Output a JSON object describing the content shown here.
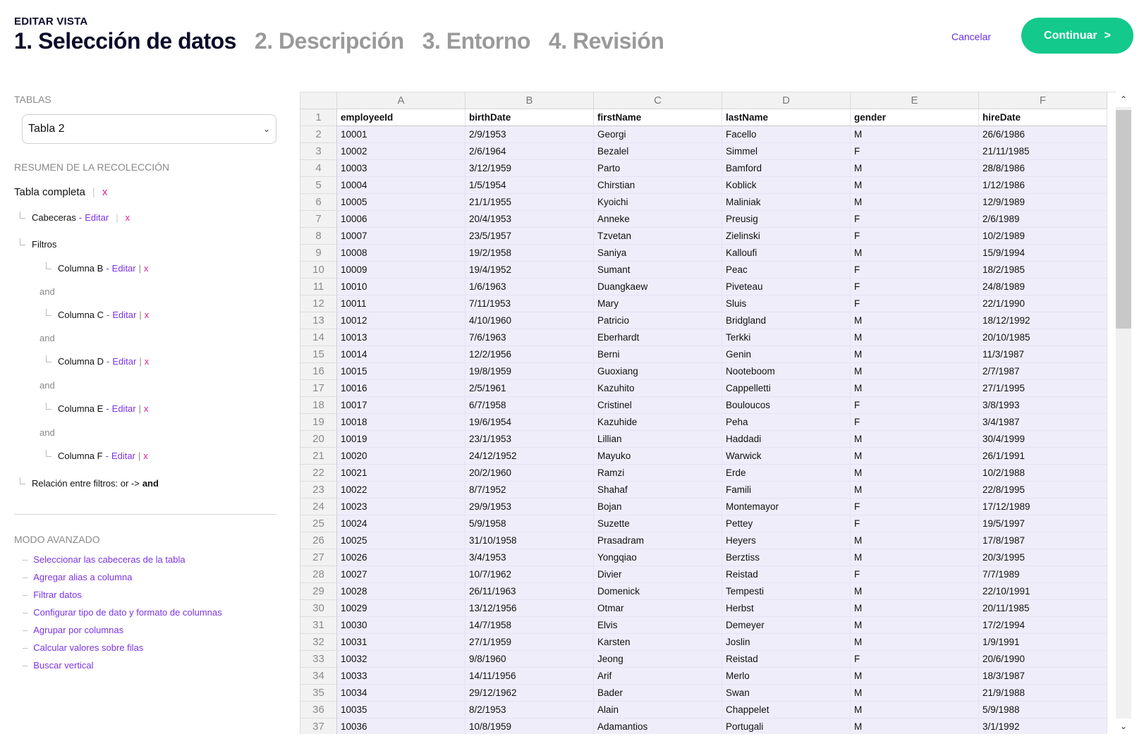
{
  "header": {
    "pretitle": "EDITAR VISTA",
    "steps": [
      {
        "label": "1. Selección de datos"
      },
      {
        "label": "2. Descripción"
      },
      {
        "label": "3. Entorno"
      },
      {
        "label": "4. Revisión"
      }
    ],
    "cancel_label": "Cancelar",
    "continue_label": "Continuar",
    "continue_arrow": ">"
  },
  "sidebar": {
    "tables_title": "TABLAS",
    "selected_table": "Tabla 2",
    "summary_title": "RESUMEN DE LA RECOLECCIÓN",
    "full_table": "Tabla completa",
    "remove_x": "x",
    "headers_label": "Cabeceras",
    "edit_label": "Editar",
    "dash": "-",
    "pipe": "|",
    "filters_label": "Filtros",
    "filters": [
      {
        "label": "Columna B"
      },
      {
        "label": "Columna C"
      },
      {
        "label": "Columna D"
      },
      {
        "label": "Columna E"
      },
      {
        "label": "Columna F"
      }
    ],
    "and_label": "and",
    "relation_label": "Relación entre filtros: or ->",
    "relation_value": "and",
    "advanced_title": "MODO AVANZADO",
    "advanced_items": [
      "Seleccionar las cabeceras de la tabla",
      "Agregar alias a columna",
      "Filtrar datos",
      "Configurar tipo de dato y formato de columnas",
      "Agrupar por columnas",
      "Calcular valores sobre filas",
      "Buscar vertical"
    ]
  },
  "grid": {
    "columns": [
      "A",
      "B",
      "C",
      "D",
      "E",
      "F"
    ],
    "header_row": [
      "employeeId",
      "birthDate",
      "firstName",
      "lastName",
      "gender",
      "hireDate"
    ],
    "rows": [
      [
        "10001",
        "2/9/1953",
        "Georgi",
        "Facello",
        "M",
        "26/6/1986"
      ],
      [
        "10002",
        "2/6/1964",
        "Bezalel",
        "Simmel",
        "F",
        "21/11/1985"
      ],
      [
        "10003",
        "3/12/1959",
        "Parto",
        "Bamford",
        "M",
        "28/8/1986"
      ],
      [
        "10004",
        "1/5/1954",
        "Chirstian",
        "Koblick",
        "M",
        "1/12/1986"
      ],
      [
        "10005",
        "21/1/1955",
        "Kyoichi",
        "Maliniak",
        "M",
        "12/9/1989"
      ],
      [
        "10006",
        "20/4/1953",
        "Anneke",
        "Preusig",
        "F",
        "2/6/1989"
      ],
      [
        "10007",
        "23/5/1957",
        "Tzvetan",
        "Zielinski",
        "F",
        "10/2/1989"
      ],
      [
        "10008",
        "19/2/1958",
        "Saniya",
        "Kalloufi",
        "M",
        "15/9/1994"
      ],
      [
        "10009",
        "19/4/1952",
        "Sumant",
        "Peac",
        "F",
        "18/2/1985"
      ],
      [
        "10010",
        "1/6/1963",
        "Duangkaew",
        "Piveteau",
        "F",
        "24/8/1989"
      ],
      [
        "10011",
        "7/11/1953",
        "Mary",
        "Sluis",
        "F",
        "22/1/1990"
      ],
      [
        "10012",
        "4/10/1960",
        "Patricio",
        "Bridgland",
        "M",
        "18/12/1992"
      ],
      [
        "10013",
        "7/6/1963",
        "Eberhardt",
        "Terkki",
        "M",
        "20/10/1985"
      ],
      [
        "10014",
        "12/2/1956",
        "Berni",
        "Genin",
        "M",
        "11/3/1987"
      ],
      [
        "10015",
        "19/8/1959",
        "Guoxiang",
        "Nooteboom",
        "M",
        "2/7/1987"
      ],
      [
        "10016",
        "2/5/1961",
        "Kazuhito",
        "Cappelletti",
        "M",
        "27/1/1995"
      ],
      [
        "10017",
        "6/7/1958",
        "Cristinel",
        "Bouloucos",
        "F",
        "3/8/1993"
      ],
      [
        "10018",
        "19/6/1954",
        "Kazuhide",
        "Peha",
        "F",
        "3/4/1987"
      ],
      [
        "10019",
        "23/1/1953",
        "Lillian",
        "Haddadi",
        "M",
        "30/4/1999"
      ],
      [
        "10020",
        "24/12/1952",
        "Mayuko",
        "Warwick",
        "M",
        "26/1/1991"
      ],
      [
        "10021",
        "20/2/1960",
        "Ramzi",
        "Erde",
        "M",
        "10/2/1988"
      ],
      [
        "10022",
        "8/7/1952",
        "Shahaf",
        "Famili",
        "M",
        "22/8/1995"
      ],
      [
        "10023",
        "29/9/1953",
        "Bojan",
        "Montemayor",
        "F",
        "17/12/1989"
      ],
      [
        "10024",
        "5/9/1958",
        "Suzette",
        "Pettey",
        "F",
        "19/5/1997"
      ],
      [
        "10025",
        "31/10/1958",
        "Prasadram",
        "Heyers",
        "M",
        "17/8/1987"
      ],
      [
        "10026",
        "3/4/1953",
        "Yongqiao",
        "Berztiss",
        "M",
        "20/3/1995"
      ],
      [
        "10027",
        "10/7/1962",
        "Divier",
        "Reistad",
        "F",
        "7/7/1989"
      ],
      [
        "10028",
        "26/11/1963",
        "Domenick",
        "Tempesti",
        "M",
        "22/10/1991"
      ],
      [
        "10029",
        "13/12/1956",
        "Otmar",
        "Herbst",
        "M",
        "20/11/1985"
      ],
      [
        "10030",
        "14/7/1958",
        "Elvis",
        "Demeyer",
        "M",
        "17/2/1994"
      ],
      [
        "10031",
        "27/1/1959",
        "Karsten",
        "Joslin",
        "M",
        "1/9/1991"
      ],
      [
        "10032",
        "9/8/1960",
        "Jeong",
        "Reistad",
        "F",
        "20/6/1990"
      ],
      [
        "10033",
        "14/11/1956",
        "Arif",
        "Merlo",
        "M",
        "18/3/1987"
      ],
      [
        "10034",
        "29/12/1962",
        "Bader",
        "Swan",
        "M",
        "21/9/1988"
      ],
      [
        "10035",
        "8/2/1953",
        "Alain",
        "Chappelet",
        "M",
        "5/9/1988"
      ],
      [
        "10036",
        "10/8/1959",
        "Adamantios",
        "Portugali",
        "M",
        "3/1/1992"
      ]
    ]
  },
  "icons": {
    "scroll_up": "chevron-up-icon",
    "scroll_down": "chevron-down-icon",
    "select": "chevron-down-icon"
  },
  "colors": {
    "accent_green": "#13c98b",
    "link_purple": "#7a34e6",
    "remove_pink": "#e0208f",
    "row_tint": "#f0edfb"
  }
}
